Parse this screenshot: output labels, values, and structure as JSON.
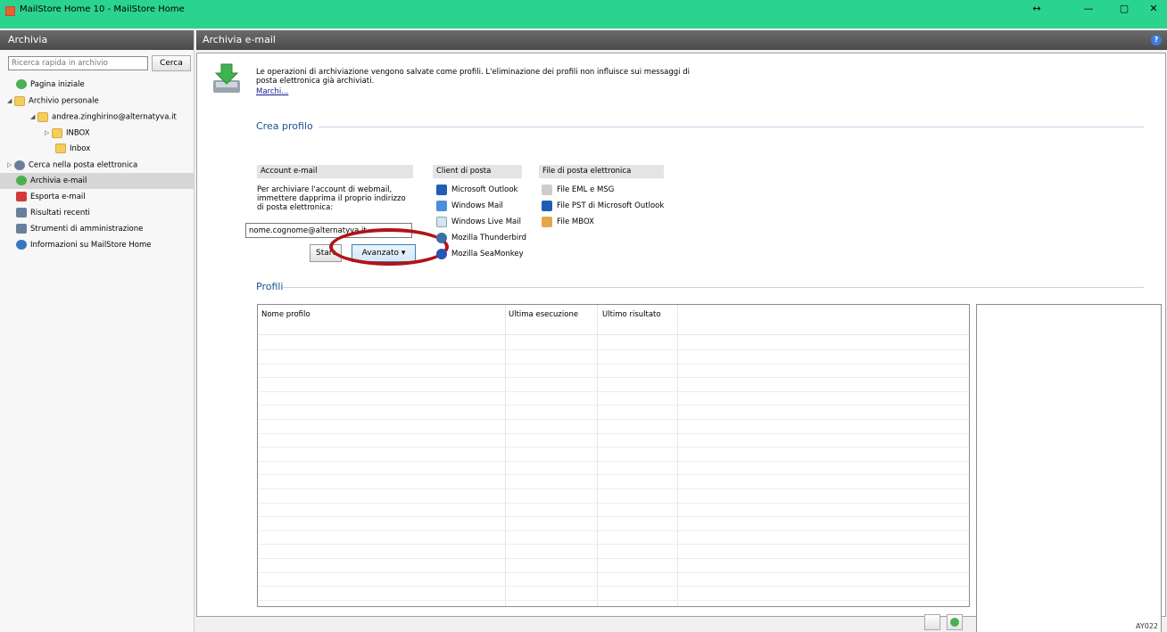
{
  "window": {
    "title": "MailStore Home 10 - MailStore Home",
    "controls": {
      "resize": "↔",
      "minimize": "—",
      "maximize": "▢",
      "close": "✕"
    }
  },
  "sidebar": {
    "header": "Archivia",
    "search_placeholder": "Ricerca rapida in archivio",
    "search_button": "Cerca",
    "items": [
      {
        "label": "Pagina iniziale",
        "icon": "home-icon"
      },
      {
        "label": "Archivio personale",
        "icon": "folder-icon"
      },
      {
        "label": "andrea.zinghirino@alternatyva.it",
        "icon": "folder-icon"
      },
      {
        "label": "INBOX",
        "icon": "folder-icon"
      },
      {
        "label": "Inbox",
        "icon": "folder-icon"
      },
      {
        "label": "Cerca nella posta elettronica",
        "icon": "search-icon"
      },
      {
        "label": "Archivia e-mail",
        "icon": "archive-icon"
      },
      {
        "label": "Esporta e-mail",
        "icon": "export-icon"
      },
      {
        "label": "Risultati recenti",
        "icon": "results-icon"
      },
      {
        "label": "Strumenti di amministrazione",
        "icon": "admin-tools-icon"
      },
      {
        "label": "Informazioni su MailStore Home",
        "icon": "info-icon"
      }
    ]
  },
  "main": {
    "header": "Archivia e-mail",
    "help": "?",
    "intro": "Le operazioni di archiviazione vengono salvate come profili. L'eliminazione dei profili non influisce sui messaggi di posta elettronica già archiviati.",
    "link": "Marchi...",
    "create_section": "Crea profilo",
    "account": {
      "header": "Account e-mail",
      "description": "Per archiviare l'account di webmail, immettere dapprima il proprio indirizzo di posta elettronica:",
      "email_value": "nome.cognome@alternatyva.it",
      "start_button": "Start",
      "advanced_button": "Avanzato ▾"
    },
    "clients": {
      "header": "Client di posta",
      "items": [
        "Microsoft Outlook",
        "Windows Mail",
        "Windows Live Mail",
        "Mozilla Thunderbird",
        "Mozilla SeaMonkey"
      ]
    },
    "files": {
      "header": "File di posta elettronica",
      "items": [
        "File EML e MSG",
        "File PST di Microsoft Outlook",
        "File MBOX"
      ]
    },
    "profiles_section": "Profili",
    "profiles_table": {
      "columns": [
        "Nome profilo",
        "Ultima esecuzione",
        "Ultimo risultato"
      ],
      "rows": []
    },
    "status": "AY022"
  }
}
